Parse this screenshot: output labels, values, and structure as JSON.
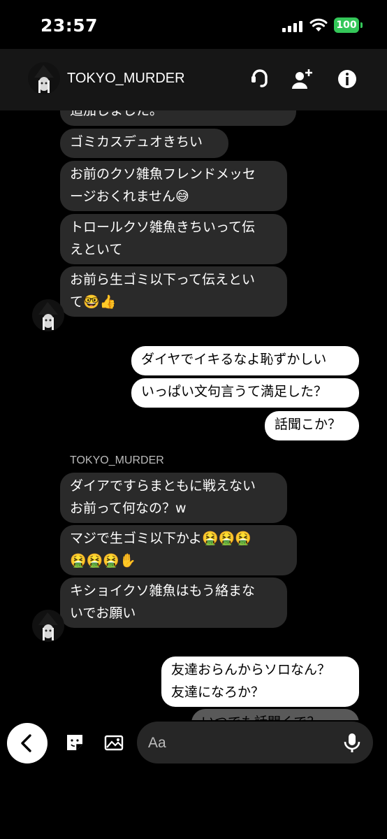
{
  "status_bar": {
    "time": "23:57",
    "battery": "100"
  },
  "header": {
    "name": "TOKYO_MURDER"
  },
  "messages": {
    "partial_top": "追加しました。",
    "group1": [
      "ゴミカスデュオきちい",
      "お前のクソ雑魚フレンドメッセ",
      "ージおくれません😅",
      "トロールクソ雑魚きちいって伝",
      "えといて",
      "お前ら生ゴミ以下って伝えとい",
      "て🤓👍"
    ],
    "outgoing1": [
      "ダイヤでイキるなよ恥ずかしい",
      "いっぱい文句言うて満足した？",
      "話聞こか？"
    ],
    "sender_label": "TOKYO_MURDER",
    "group2": [
      "ダイアですらまともに戦えない",
      "お前って何なの？w",
      "マジで生ゴミ以下かよ🤮🤮🤮",
      "🤮🤮🤮✋",
      "キショイクソ雑魚はもう絡まな",
      "いでお願い"
    ],
    "outgoing2": [
      "友達おらんからソロなん？",
      "友達になろか？",
      "いつでも話聞くで？"
    ]
  },
  "composer": {
    "placeholder": "Aa"
  },
  "icons": {
    "header": [
      "call-icon",
      "add-person-icon",
      "info-icon"
    ],
    "composer": [
      "back-icon",
      "sticker-icon",
      "gallery-icon",
      "mic-icon"
    ]
  },
  "colors": {
    "background": "#000000",
    "incoming_bubble": "#2a2a2a",
    "outgoing_bubble": "#ffffff",
    "battery": "#34c759"
  }
}
